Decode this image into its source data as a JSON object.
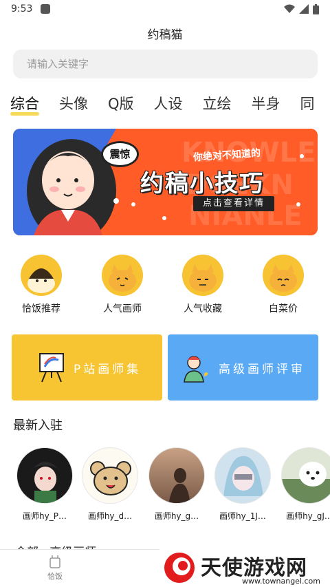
{
  "status": {
    "time": "9:53"
  },
  "app": {
    "title": "约稿猫"
  },
  "search": {
    "placeholder": "请输入关键字"
  },
  "tabs": [
    "综合",
    "头像",
    "Q版",
    "人设",
    "立绘",
    "半身",
    "同"
  ],
  "banner": {
    "shock": "震惊",
    "small": "你绝对不知道的",
    "big": "约稿小技巧",
    "button": "点击查看详情",
    "bg_text": "KNOWLEDGE"
  },
  "categories": [
    {
      "label": "恰饭推荐",
      "icon": "cat-face-icon"
    },
    {
      "label": "人气画师",
      "icon": "cat-face-icon"
    },
    {
      "label": "人气收藏",
      "icon": "cat-face-icon"
    },
    {
      "label": "白菜价",
      "icon": "cat-face-icon"
    }
  ],
  "promos": {
    "left": "P站画师集",
    "right": "高级画师评审"
  },
  "new_section": {
    "title": "最新入驻"
  },
  "artists": [
    {
      "name": "画师hy_P…"
    },
    {
      "name": "画师hy_d…"
    },
    {
      "name": "画师hy_g…"
    },
    {
      "name": "画师hy_1J…"
    },
    {
      "name": "画师hy_gJ…"
    }
  ],
  "peek_section": {
    "title": "全部 · 高级画师"
  },
  "bottom_nav": {
    "home": "恰饭"
  },
  "watermark": {
    "brand": "天使游戏网",
    "url": "www.townangel.com"
  },
  "colors": {
    "accent_yellow": "#f8c532",
    "accent_blue": "#5aa9f5",
    "banner_orange": "#ff5a25"
  }
}
